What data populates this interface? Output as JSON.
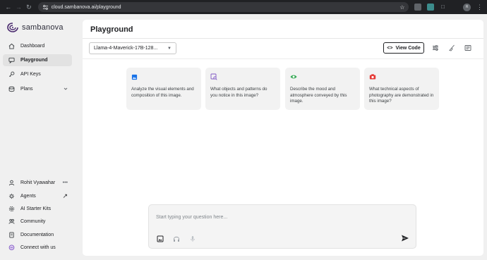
{
  "browser": {
    "url": "cloud.sambanova.ai/playground",
    "profile_initial": "R"
  },
  "sidebar": {
    "brand": "sambanova",
    "items": [
      {
        "label": "Dashboard",
        "icon": "home-icon"
      },
      {
        "label": "Playground",
        "icon": "chat-icon",
        "active": true
      },
      {
        "label": "API Keys",
        "icon": "key-icon"
      },
      {
        "label": "Plans",
        "icon": "plans-icon",
        "trail": "chevron-down"
      }
    ],
    "bottom_items": [
      {
        "label": "Rohit Vyawahar",
        "icon": "user-icon",
        "trail": "•••"
      },
      {
        "label": "Agents",
        "icon": "agents-icon",
        "trail": "↗"
      },
      {
        "label": "AI Starter Kits",
        "icon": "gear-icon"
      },
      {
        "label": "Community",
        "icon": "community-icon"
      },
      {
        "label": "Documentation",
        "icon": "doc-icon"
      },
      {
        "label": "Connect with us",
        "icon": "message-icon"
      }
    ]
  },
  "main": {
    "title": "Playground",
    "model": "Llama-4-Maverick-17B-128...",
    "view_code_label": "View Code",
    "cards": [
      {
        "text": "Analyze the visual elements and composition of this image.",
        "icon": "image-icon",
        "color": "#1a73e8"
      },
      {
        "text": "What objects and patterns do you notice in this image?",
        "icon": "image-search-icon",
        "color": "#7e57c2"
      },
      {
        "text": "Describe the mood and atmosphere conveyed by this image.",
        "icon": "eye-icon",
        "color": "#34a853"
      },
      {
        "text": "What technical aspects of photography are demonstrated in this image?",
        "icon": "camera-icon",
        "color": "#e53935"
      }
    ],
    "composer": {
      "placeholder": "Start typing your question here..."
    }
  }
}
